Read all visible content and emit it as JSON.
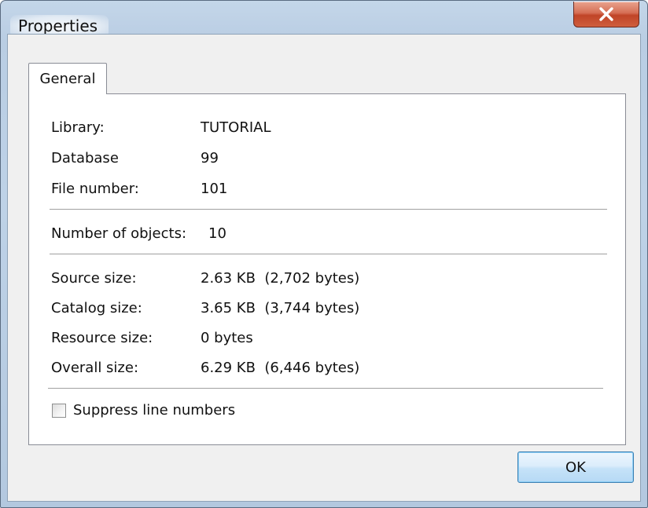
{
  "window": {
    "title": "Properties"
  },
  "tabs": [
    {
      "label": "General",
      "selected": true
    }
  ],
  "general": {
    "library": {
      "label": "Library:",
      "value": "TUTORIAL"
    },
    "database": {
      "label": "Database",
      "value": "99"
    },
    "file_number": {
      "label": "File number:",
      "value": "101"
    },
    "number_of_objects": {
      "label": "Number of objects:",
      "value": "10"
    },
    "source_size": {
      "label": "Source size:",
      "value": "2.63 KB  (2,702 bytes)"
    },
    "catalog_size": {
      "label": "Catalog size:",
      "value": "3.65 KB  (3,744 bytes)"
    },
    "resource_size": {
      "label": "Resource size:",
      "value": "0 bytes"
    },
    "overall_size": {
      "label": "Overall size:",
      "value": "6.29 KB  (6,446 bytes)"
    },
    "suppress_line_numbers": {
      "label": "Suppress line numbers",
      "checked": false
    }
  },
  "buttons": {
    "ok": "OK"
  },
  "icons": {
    "close": "close-icon"
  },
  "colors": {
    "close_button": "#c8472a",
    "ok_button_border": "#3c7fb1",
    "window_frame": "#b9cde3"
  }
}
